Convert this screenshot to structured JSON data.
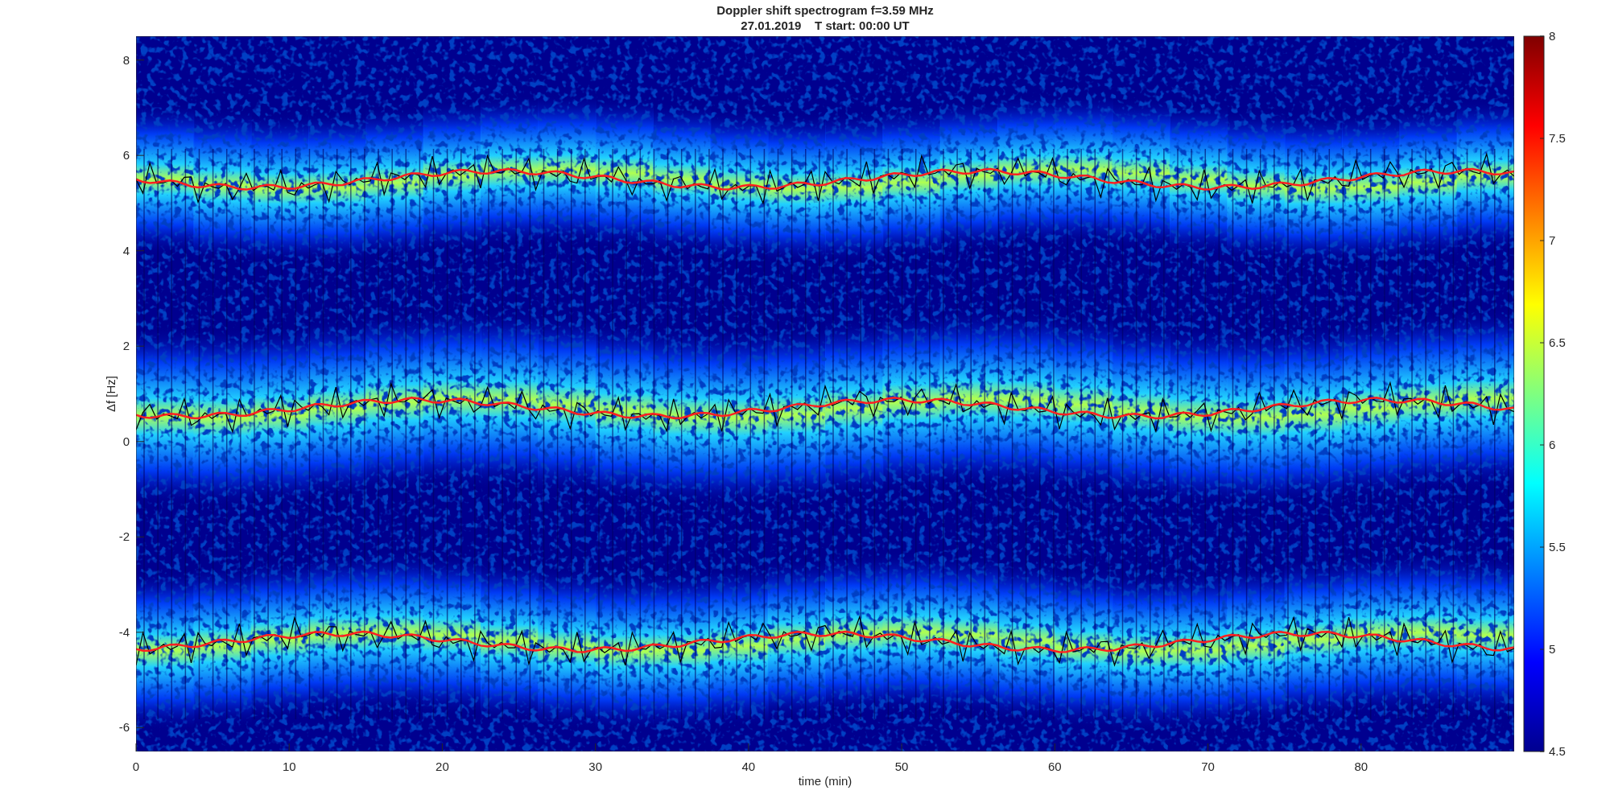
{
  "figure": {
    "title": "Doppler shift spectrogram f=3.59 MHz",
    "subtitle": "27.01.2019    T start: 00:00 UT",
    "xlabel": "time (min)",
    "ylabel": "Δf [Hz]",
    "xticks": [
      "0",
      "10",
      "20",
      "30",
      "40",
      "50",
      "60",
      "70",
      "80"
    ],
    "yticks": [
      "8",
      "6",
      "4",
      "2",
      "0",
      "-2",
      "-4",
      "-6"
    ],
    "colorbar": {
      "ticks": [
        "8",
        "7.5",
        "7",
        "6.5",
        "6",
        "5.5",
        "5",
        "4.5"
      ]
    }
  }
}
